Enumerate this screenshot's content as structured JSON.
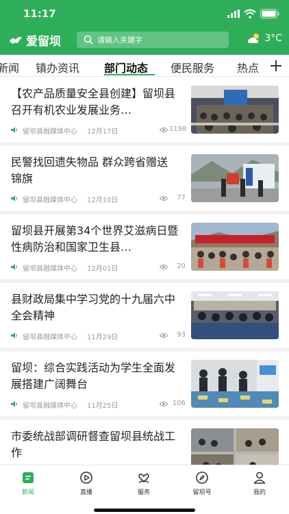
{
  "status": {
    "time": "11:17"
  },
  "header": {
    "logo_text": "爱留坝",
    "search_placeholder": "请输入关键字",
    "weather_temp": "3°C"
  },
  "tabs": [
    "新闻",
    "镇办资讯",
    "部门动态",
    "便民服务",
    "热点"
  ],
  "active_tab": "部门动态",
  "articles": [
    {
      "title": "【农产品质量安全县创建】留坝县召开有机农业发展业务…",
      "source": "留坝县融媒体中心",
      "date": "12月17日",
      "views": "1198"
    },
    {
      "title": "民警找回遗失物品 群众跨省赠送锦旗",
      "source": "留坝县融媒体中心",
      "date": "12月10日",
      "views": "77"
    },
    {
      "title": "留坝县开展第34个世界艾滋病日暨性病防治和国家卫生县…",
      "source": "留坝县融媒体中心",
      "date": "12月01日",
      "views": "20"
    },
    {
      "title": "县财政局集中学习党的十九届六中全会精神",
      "source": "留坝县融媒体中心",
      "date": "11月29日",
      "views": "93"
    },
    {
      "title": "留坝：综合实践活动为学生全面发展搭建广阔舞台",
      "source": "留坝县融媒体中心",
      "date": "11月25日",
      "views": "106"
    },
    {
      "title": "市委统战部调研督查留坝县统战工作",
      "source": "",
      "date": "",
      "views": ""
    }
  ],
  "bottom_nav": [
    {
      "label": "新闻",
      "icon": "news-icon",
      "active": true
    },
    {
      "label": "直播",
      "icon": "live-play-icon",
      "active": false
    },
    {
      "label": "服务",
      "icon": "service-icon",
      "active": false
    },
    {
      "label": "留坝号",
      "icon": "compass-icon",
      "active": false
    },
    {
      "label": "我的",
      "icon": "user-icon",
      "active": false
    }
  ],
  "colors": {
    "brand_green": "#2fae5a"
  }
}
